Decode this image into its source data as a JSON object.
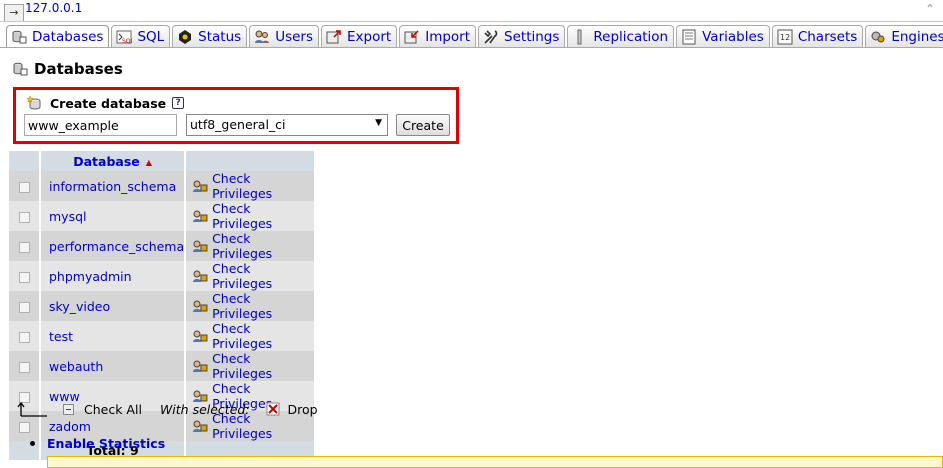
{
  "header": {
    "server": "127.0.0.1",
    "toggle_icon": "arrow-right-icon"
  },
  "tabs": [
    {
      "label": "Databases",
      "icon": "database-icon",
      "active": true
    },
    {
      "label": "SQL",
      "icon": "sql-icon",
      "active": false
    },
    {
      "label": "Status",
      "icon": "status-icon",
      "active": false
    },
    {
      "label": "Users",
      "icon": "users-icon",
      "active": false
    },
    {
      "label": "Export",
      "icon": "export-icon",
      "active": false
    },
    {
      "label": "Import",
      "icon": "import-icon",
      "active": false
    },
    {
      "label": "Settings",
      "icon": "settings-icon",
      "active": false
    },
    {
      "label": "Replication",
      "icon": "replication-icon",
      "active": false
    },
    {
      "label": "Variables",
      "icon": "variables-icon",
      "active": false
    },
    {
      "label": "Charsets",
      "icon": "charsets-icon",
      "active": false
    },
    {
      "label": "Engines",
      "icon": "engines-icon",
      "active": false
    }
  ],
  "page": {
    "title": "Databases"
  },
  "create": {
    "label": "Create database",
    "name_value": "www_example",
    "collation_value": "utf8_general_ci",
    "button_label": "Create"
  },
  "table": {
    "header_name": "Database",
    "action_label": "Check Privileges",
    "rows": [
      "information_schema",
      "mysql",
      "performance_schema",
      "phpmyadmin",
      "sky_video",
      "test",
      "webauth",
      "www",
      "zadom"
    ],
    "total": "Total: 9"
  },
  "bulk": {
    "check_all": "Check All",
    "with_selected": "With selected:",
    "drop": "Drop"
  },
  "links": {
    "enable_statistics": "Enable Statistics"
  },
  "colors": {
    "highlight": "#e00000",
    "link": "#0000cc",
    "header_bg": "#d3dce3"
  }
}
